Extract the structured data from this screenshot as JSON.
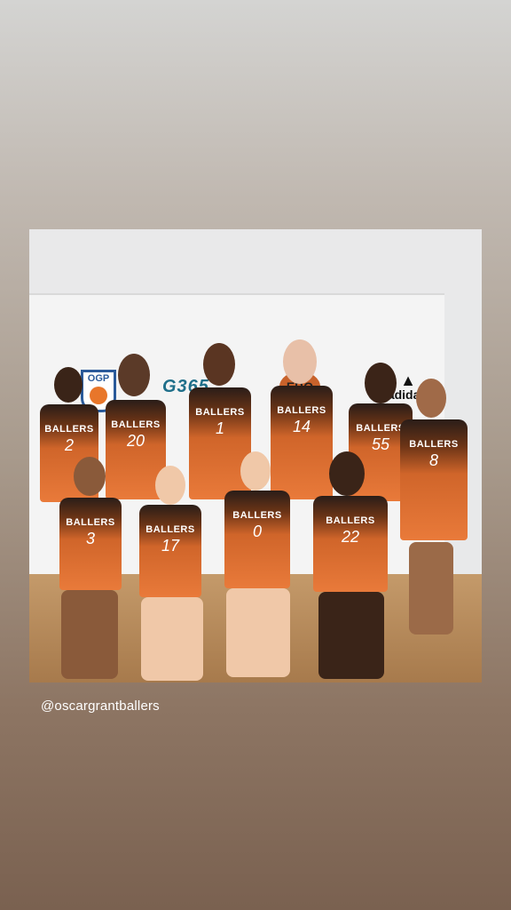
{
  "photo": {
    "banner_logos": [
      "OGP",
      "G365",
      "EBO",
      "adidas"
    ],
    "team_name": "BALLERS",
    "back_row_numbers": [
      "2",
      "20",
      "1",
      "14",
      "55",
      "8"
    ],
    "front_row_numbers": [
      "3",
      "17",
      "0",
      "22"
    ]
  },
  "caption": {
    "handle": "@oscargrantballers"
  }
}
